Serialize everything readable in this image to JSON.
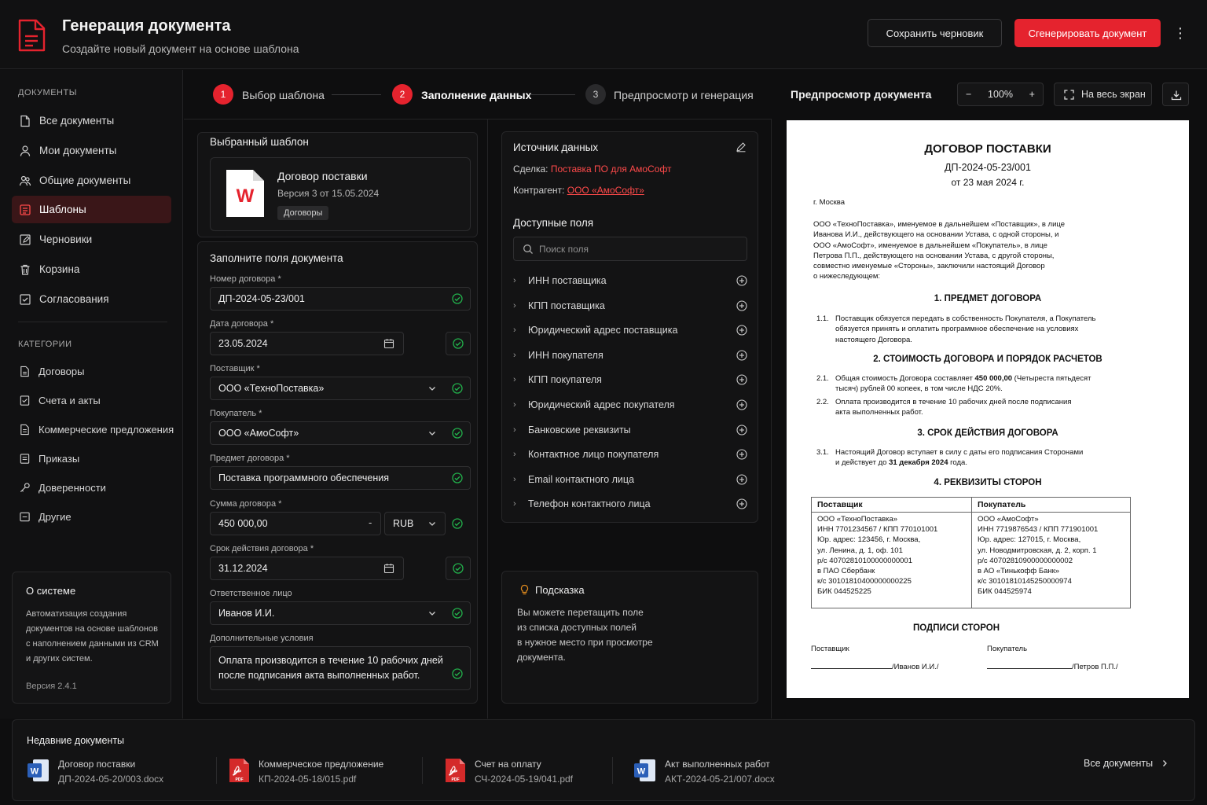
{
  "header": {
    "title": "Генерация документа",
    "subtitle": "Создайте новый документ на основе шаблона",
    "save_draft": "Сохранить черновик",
    "generate": "Сгенерировать документ"
  },
  "sidebar": {
    "docs_label": "ДОКУМЕНТЫ",
    "items": [
      {
        "label": "Все документы",
        "icon": "file-icon"
      },
      {
        "label": "Мои документы",
        "icon": "user-icon"
      },
      {
        "label": "Общие документы",
        "icon": "users-icon"
      },
      {
        "label": "Шаблоны",
        "icon": "template-icon",
        "active": true
      },
      {
        "label": "Черновики",
        "icon": "edit-icon"
      },
      {
        "label": "Корзина",
        "icon": "trash-icon"
      },
      {
        "label": "Согласования",
        "icon": "approval-icon"
      }
    ],
    "cat_label": "КАТЕГОРИИ",
    "categories": [
      "Договоры",
      "Счета и акты",
      "Коммерческие предложения",
      "Приказы",
      "Доверенности",
      "Другие"
    ],
    "about": {
      "title": "О системе",
      "desc": "Автоматизация создания документов на основе шаблонов с наполнением данными из CRM и других систем.",
      "version": "Версия 2.4.1"
    }
  },
  "steps": [
    {
      "num": "1",
      "label": "Выбор шаблона"
    },
    {
      "num": "2",
      "label": "Заполнение данных"
    },
    {
      "num": "3",
      "label": "Предпросмотр и генерация"
    }
  ],
  "template": {
    "section_title": "Выбранный шаблон",
    "name": "Договор поставки",
    "version": "Версия 3 от 15.05.2024",
    "tag": "Договоры"
  },
  "form": {
    "title": "Заполните поля документа",
    "contract_no_label": "Номер договора *",
    "contract_no": "ДП-2024-05-23/001",
    "date_label": "Дата договора *",
    "date": "23.05.2024",
    "supplier_label": "Поставщик *",
    "supplier": "ООО «ТехноПоставка»",
    "buyer_label": "Покупатель *",
    "buyer": "ООО «АмоСофт»",
    "subject_label": "Предмет договора *",
    "subject": "Поставка программного обеспечения",
    "amount_label": "Сумма договора *",
    "amount": "450 000,00",
    "currency": "RUB",
    "term_label": "Срок действия договора *",
    "term": "31.12.2024",
    "responsible_label": "Ответственное лицо",
    "responsible": "Иванов И.И.",
    "extra_label": "Дополнительные условия",
    "extra_1": "Оплата производится в течение 10 рабочих дней",
    "extra_2": "после подписания акта выполненных работ."
  },
  "source": {
    "title": "Источник данных",
    "deal_label": "Сделка:",
    "deal": "Поставка ПО для АмоСофт",
    "counterparty_label": "Контрагент:",
    "counterparty": "ООО «АмоСофт»"
  },
  "fields": {
    "title": "Доступные поля",
    "search_placeholder": "Поиск поля",
    "items": [
      "ИНН поставщика",
      "КПП поставщика",
      "Юридический адрес поставщика",
      "ИНН покупателя",
      "КПП покупателя",
      "Юридический адрес покупателя",
      "Банковские реквизиты",
      "Контактное лицо покупателя",
      "Email контактного лица",
      "Телефон контактного лица"
    ]
  },
  "hint": {
    "title": "Подсказка",
    "lines": [
      "Вы можете перетащить поле",
      "из списка доступных полей",
      "в нужное место при просмотре",
      "документа."
    ]
  },
  "preview": {
    "title": "Предпросмотр документа",
    "zoom": "100%",
    "fullscreen": "На весь экран"
  },
  "doc": {
    "title": "ДОГОВОР ПОСТАВКИ",
    "number": "ДП-2024-05-23/001",
    "date": "от 23 мая 2024 г.",
    "city": "г. Москва",
    "intro": [
      "ООО «ТехноПоставка», именуемое в дальнейшем «Поставщик», в лице",
      "Иванова И.И., действующего на основании Устава, с одной стороны, и",
      "ООО «АмоСофт», именуемое в дальнейшем «Покупатель», в лице",
      "Петрова П.П., действующего на основании Устава, с другой стороны,",
      "совместно именуемые «Стороны», заключили настоящий Договор",
      "о нижеследующем:"
    ],
    "s1": "1. ПРЕДМЕТ ДОГОВОРА",
    "s1_1_no": "1.1.",
    "s1_1": [
      "Поставщик обязуется передать в собственность Покупателя, а Покупатель",
      "обязуется принять и оплатить программное обеспечение на условиях",
      "настоящего Договора."
    ],
    "s2": "2. СТОИМОСТЬ ДОГОВОРА И ПОРЯДОК РАСЧЕТОВ",
    "s2_1_no": "2.1.",
    "s2_1_a": "Общая стоимость Договора составляет ",
    "s2_1_bold": "450 000,00",
    "s2_1_b": " (Четыреста пятьдесят",
    "s2_1_c": "тысяч) рублей 00 копеек, в том числе НДС 20%.",
    "s2_2_no": "2.2.",
    "s2_2": [
      "Оплата производится в течение 10 рабочих дней после подписания",
      "акта выполненных работ."
    ],
    "s3": "3. СРОК ДЕЙСТВИЯ ДОГОВОРА",
    "s3_1_no": "3.1.",
    "s3_1_a": "Настоящий Договор вступает в силу с даты его подписания Сторонами",
    "s3_1_b": "и действует до ",
    "s3_1_bold": "31 декабря 2024",
    "s3_1_c": " года.",
    "s4": "4. РЕКВИЗИТЫ СТОРОН",
    "supplier_h": "Поставщик",
    "buyer_h": "Покупатель",
    "supplier_req": [
      "ООО «ТехноПоставка»",
      "ИНН 7701234567 / КПП 770101001",
      "Юр. адрес: 123456, г. Москва,",
      "ул. Ленина, д. 1, оф. 101",
      "р/с 40702810100000000001",
      "в ПАО Сбербанк",
      "к/с 30101810400000000225",
      "БИК 044525225"
    ],
    "buyer_req": [
      "ООО «АмоСофт»",
      "ИНН 7719876543 / КПП 771901001",
      "Юр. адрес: 127015, г. Москва,",
      "ул. Новодмитровская, д. 2, корп. 1",
      "р/с 40702810900000000002",
      "в АО «Тинькофф Банк»",
      "к/с 30101810145250000974",
      "БИК 044525974"
    ],
    "signs": "ПОДПИСИ СТОРОН",
    "sign_supplier": "Поставщик",
    "sign_buyer": "Покупатель",
    "sign_supplier_name": "/Иванов И.И./",
    "sign_buyer_name": "/Петров П.П./"
  },
  "recent": {
    "title": "Недавние документы",
    "items": [
      {
        "name": "Договор поставки",
        "file": "ДП-2024-05-20/003.docx",
        "icon": "word-icon"
      },
      {
        "name": "Коммерческое предложение",
        "file": "КП-2024-05-18/015.pdf",
        "icon": "pdf-icon"
      },
      {
        "name": "Счет на оплату",
        "file": "СЧ-2024-05-19/041.pdf",
        "icon": "pdf-icon"
      },
      {
        "name": "Акт выполненных работ",
        "file": "АКТ-2024-05-21/007.docx",
        "icon": "word-icon"
      }
    ],
    "all": "Все документы"
  },
  "colors": {
    "accent": "#e5232e",
    "success": "#22b04b",
    "bg": "#0e0e0f"
  }
}
